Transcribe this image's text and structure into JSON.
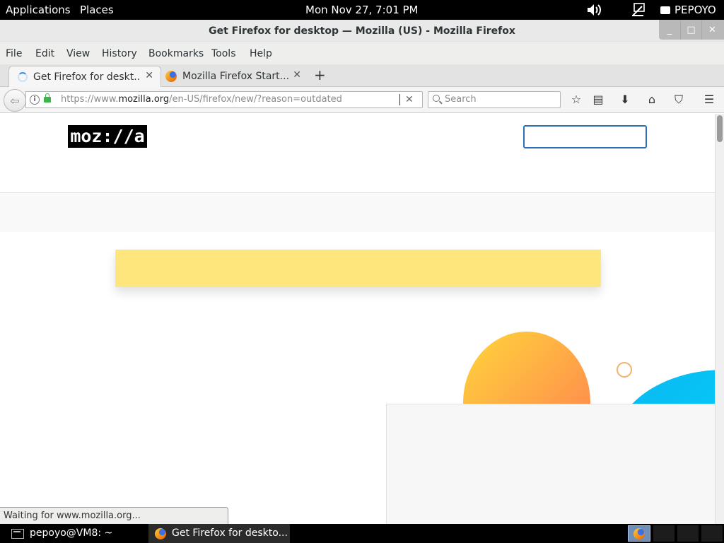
{
  "topbar": {
    "applications": "Applications",
    "places": "Places",
    "clock": "Mon Nov 27,  7:01 PM",
    "user": "PEPOYO"
  },
  "window": {
    "title": "Get Firefox for desktop — Mozilla (US) - Mozilla Firefox",
    "minimize_glyph": "_",
    "maximize_glyph": "□",
    "close_glyph": "✕"
  },
  "menu": [
    "File",
    "Edit",
    "View",
    "History",
    "Bookmarks",
    "Tools",
    "Help"
  ],
  "tabs": [
    {
      "label": "Get Firefox for deskt...",
      "icon": "loading-spinner-icon",
      "active": true
    },
    {
      "label": "Mozilla Firefox Start...",
      "icon": "firefox-icon",
      "active": false
    }
  ],
  "tab_close_glyph": "✕",
  "new_tab_glyph": "+",
  "navbar": {
    "back_glyph": "⇦",
    "info_glyph": "i",
    "url_prefix": "https://www.",
    "url_domain": "mozilla.org",
    "url_path": "/en-US/firefox/new/?reason=outdated",
    "clear_glyph": "✕",
    "search_placeholder": "Search",
    "icons": {
      "bookmark": "☆",
      "reading_list": "▤",
      "downloads": "⬇",
      "home": "⌂",
      "pocket": "⛉",
      "menu": "☰"
    }
  },
  "page": {
    "logo_text": "moz://a",
    "notice_color": "#ffe67c"
  },
  "status_text": "Waiting for www.mozilla.org...",
  "taskbar": {
    "terminal_label": "pepoyo@VM8: ~",
    "firefox_label": "Get Firefox for deskto..."
  }
}
